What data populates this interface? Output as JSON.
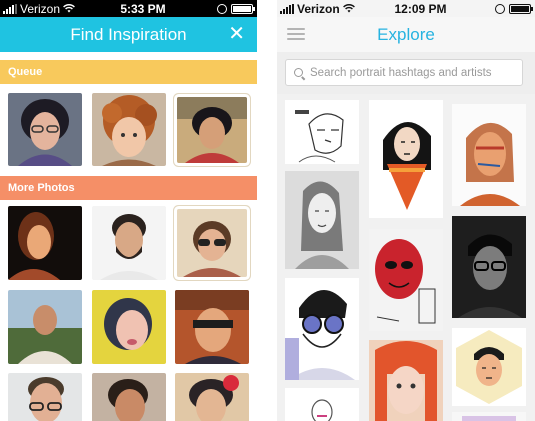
{
  "left_screen": {
    "status": {
      "carrier": "Verizon",
      "time": "5:33 PM"
    },
    "header": {
      "title": "Find Inspiration",
      "close_label": "✕"
    },
    "sections": {
      "queue": "Queue",
      "more_photos": "More Photos"
    }
  },
  "right_screen": {
    "status": {
      "carrier": "Verizon",
      "time": "12:09 PM"
    },
    "header": {
      "title": "Explore"
    },
    "search": {
      "placeholder": "Search portrait hashtags and artists"
    }
  },
  "colors": {
    "find_header": "#1fc3e1",
    "queue_bar": "#f8c95c",
    "more_photos_bar": "#f58f67",
    "explore_title": "#27b3e0"
  },
  "icons": [
    "signal-bars-icon",
    "wifi-icon",
    "alarm-icon",
    "battery-icon",
    "close-icon",
    "menu-icon",
    "search-icon"
  ]
}
